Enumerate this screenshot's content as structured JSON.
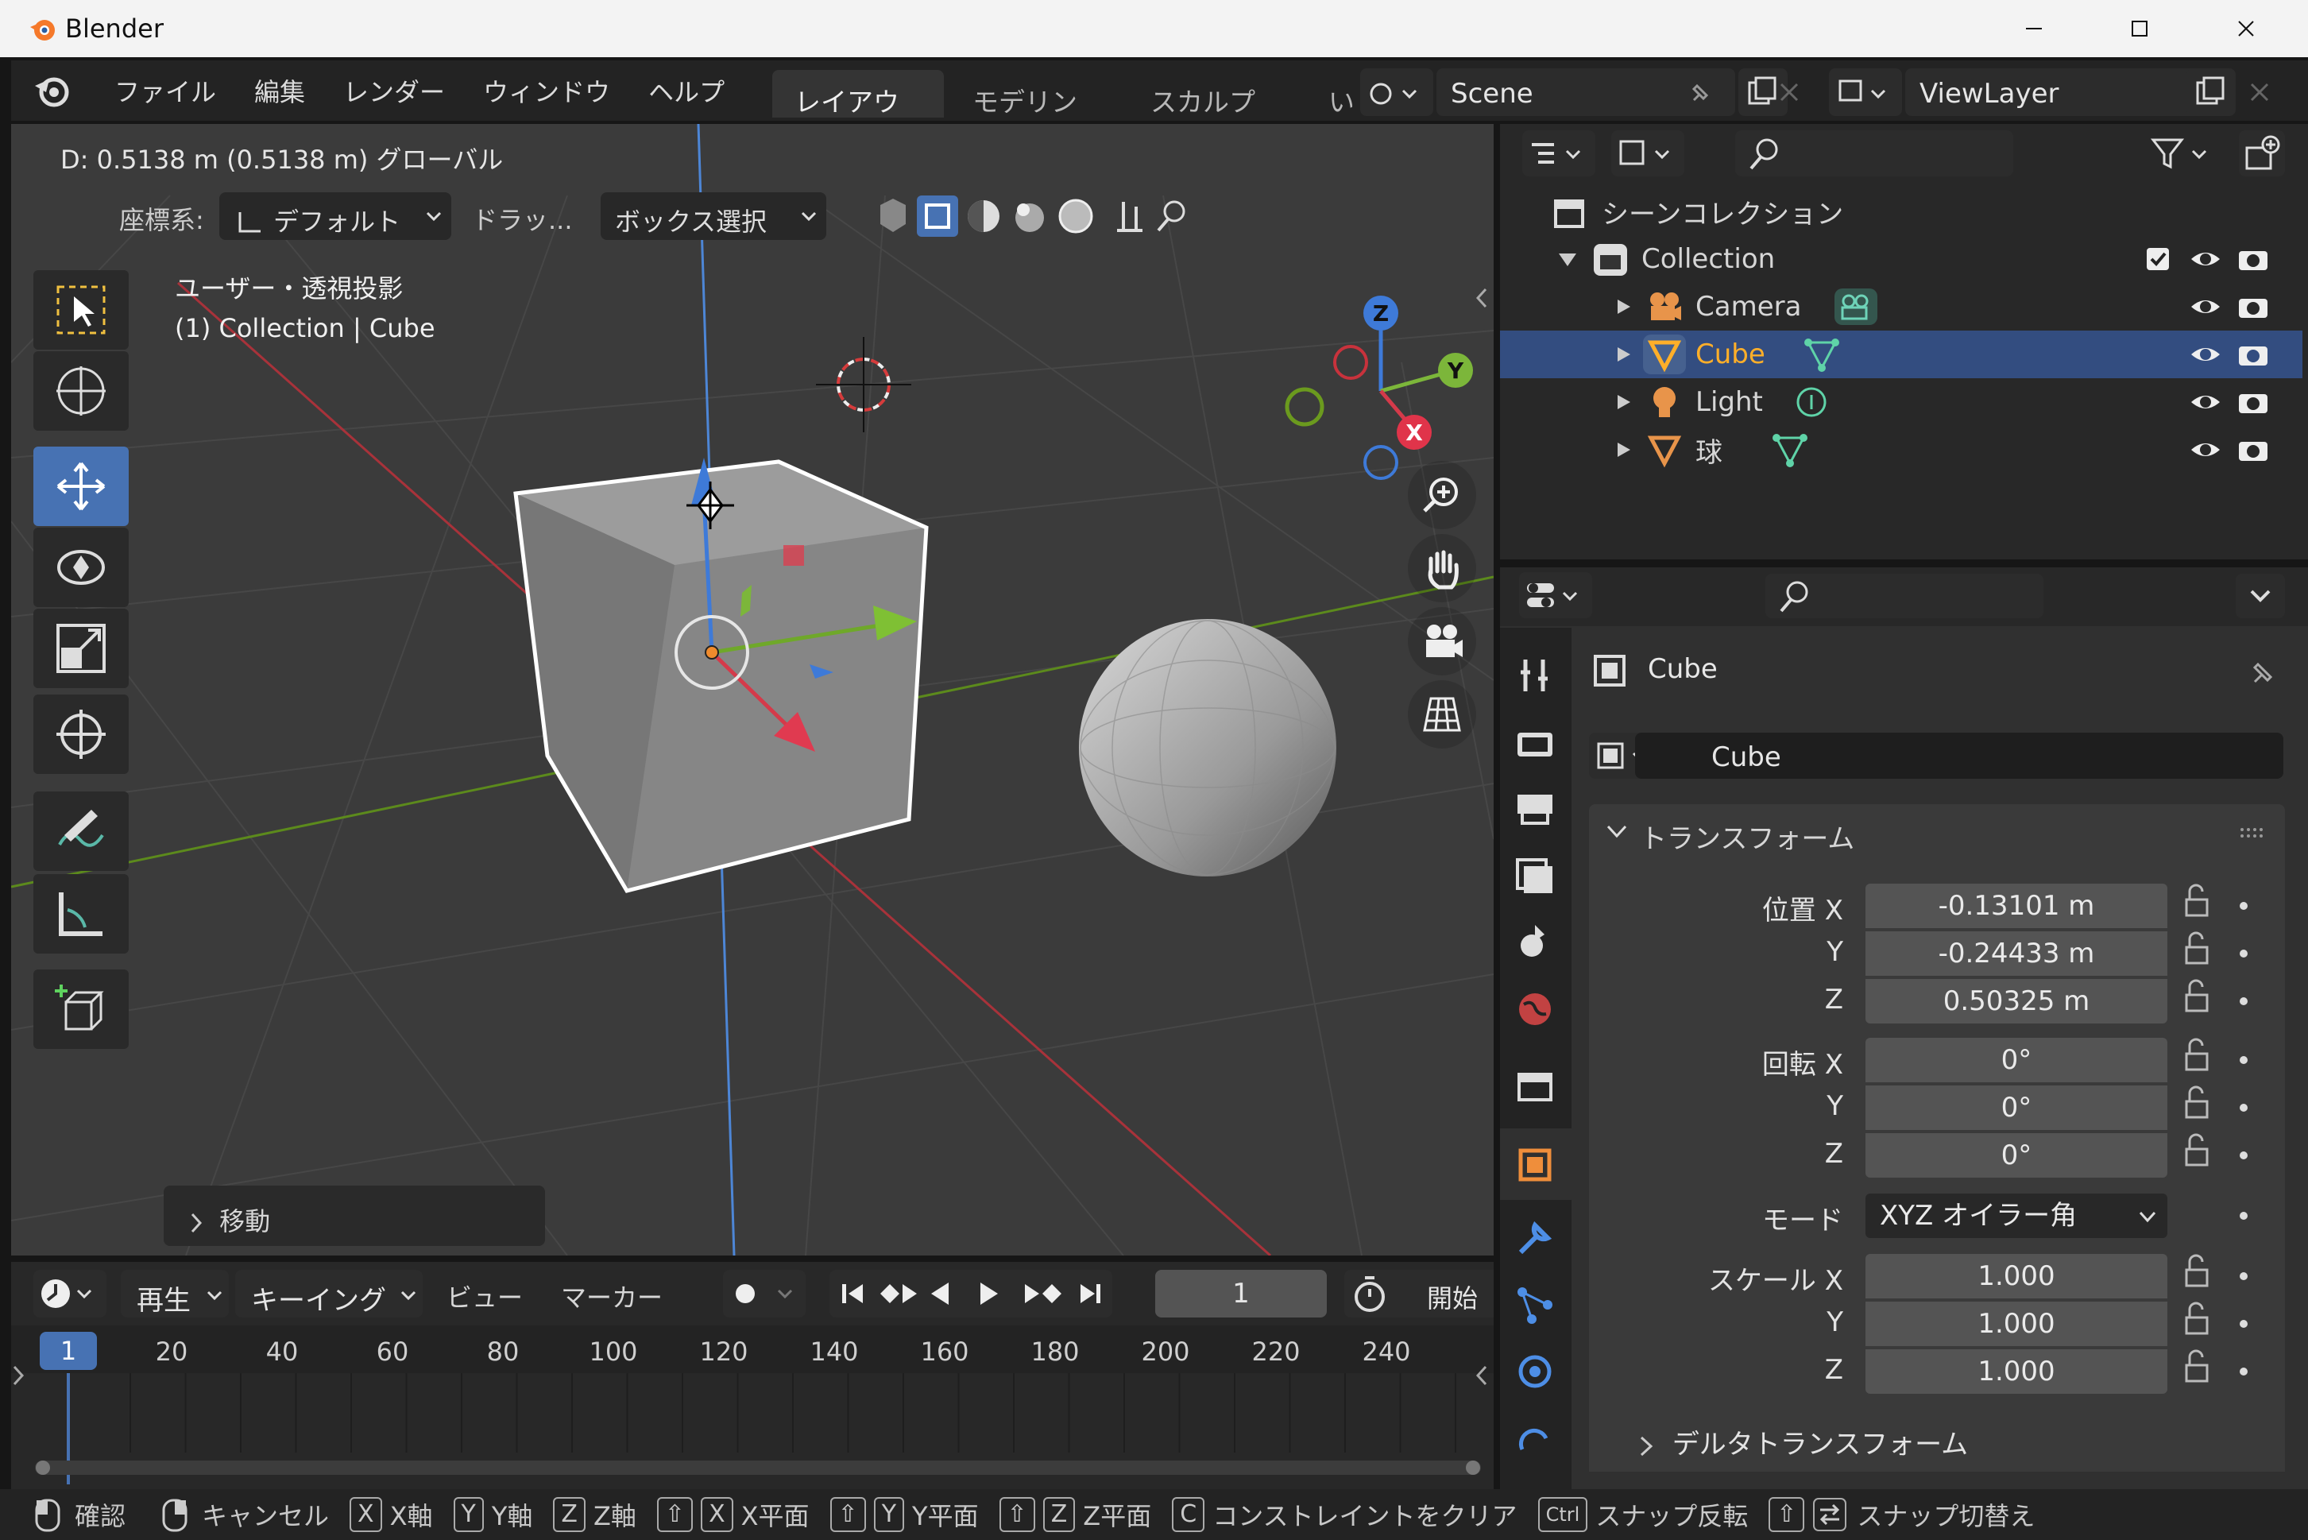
{
  "app": {
    "title": "Blender"
  },
  "menu": {
    "items": [
      "ファイル",
      "編集",
      "レンダー",
      "ウィンドウ",
      "ヘルプ"
    ]
  },
  "workspace_tabs": [
    "レイアウト",
    "モデリング",
    "スカルプト",
    "い"
  ],
  "scene": {
    "name": "Scene",
    "view_layer": "ViewLayer"
  },
  "viewport": {
    "status_text": "D: 0.5138 m (0.5138 m) グローバル",
    "coord_label": "座標系:",
    "coord_value": "デフォルト",
    "drag_label": "ドラッ...",
    "select_mode": "ボックス選択",
    "view_name": "ユーザー・透視投影",
    "context": "(1) Collection | Cube",
    "op_panel": "移動",
    "axis_labels": {
      "x": "X",
      "y": "Y",
      "z": "Z"
    }
  },
  "outliner": {
    "root": "シーンコレクション",
    "collection": "Collection",
    "items": [
      {
        "name": "Camera",
        "color": "#e8e8e8"
      },
      {
        "name": "Cube",
        "color": "#ffaf29"
      },
      {
        "name": "Light",
        "color": "#e8e8e8"
      },
      {
        "name": "球",
        "color": "#e8e8e8"
      }
    ]
  },
  "properties": {
    "object_name": "Cube",
    "data_name": "Cube",
    "panel_title": "トランスフォーム",
    "location_label": "位置 X",
    "rotation_label": "回転 X",
    "scale_label": "スケール X",
    "y_label": "Y",
    "z_label": "Z",
    "location": [
      "-0.13101 m",
      "-0.24433 m",
      "0.50325 m"
    ],
    "rotation": [
      "0°",
      "0°",
      "0°"
    ],
    "mode_label": "モード",
    "mode_value": "XYZ オイラー角",
    "scale": [
      "1.000",
      "1.000",
      "1.000"
    ],
    "delta_panel": "デルタトランスフォーム"
  },
  "timeline": {
    "menus": [
      "再生",
      "キーイング",
      "ビュー",
      "マーカー"
    ],
    "current_frame": "1",
    "start_label": "開始",
    "ruler": [
      "1",
      "20",
      "40",
      "60",
      "80",
      "100",
      "120",
      "140",
      "160",
      "180",
      "200",
      "220",
      "240"
    ]
  },
  "statusbar": {
    "confirm": "確認",
    "cancel": "キャンセル",
    "x_axis": "X軸",
    "y_axis": "Y軸",
    "z_axis": "Z軸",
    "x_plane": "X平面",
    "y_plane": "Y平面",
    "z_plane": "Z平面",
    "clear": "コンストレイントをクリア",
    "snap_invert": "スナップ反転",
    "snap_toggle": "スナップ切替え",
    "keys": {
      "x": "X",
      "y": "Y",
      "z": "Z",
      "c": "C",
      "ctrl": "Ctrl",
      "shift": "⇧"
    }
  },
  "colors": {
    "accent": "#4772b3",
    "selected_text": "#ffaf29",
    "x_axis": "#c8323c",
    "y_axis": "#6b9a1e",
    "z_axis": "#3e7ad8"
  }
}
